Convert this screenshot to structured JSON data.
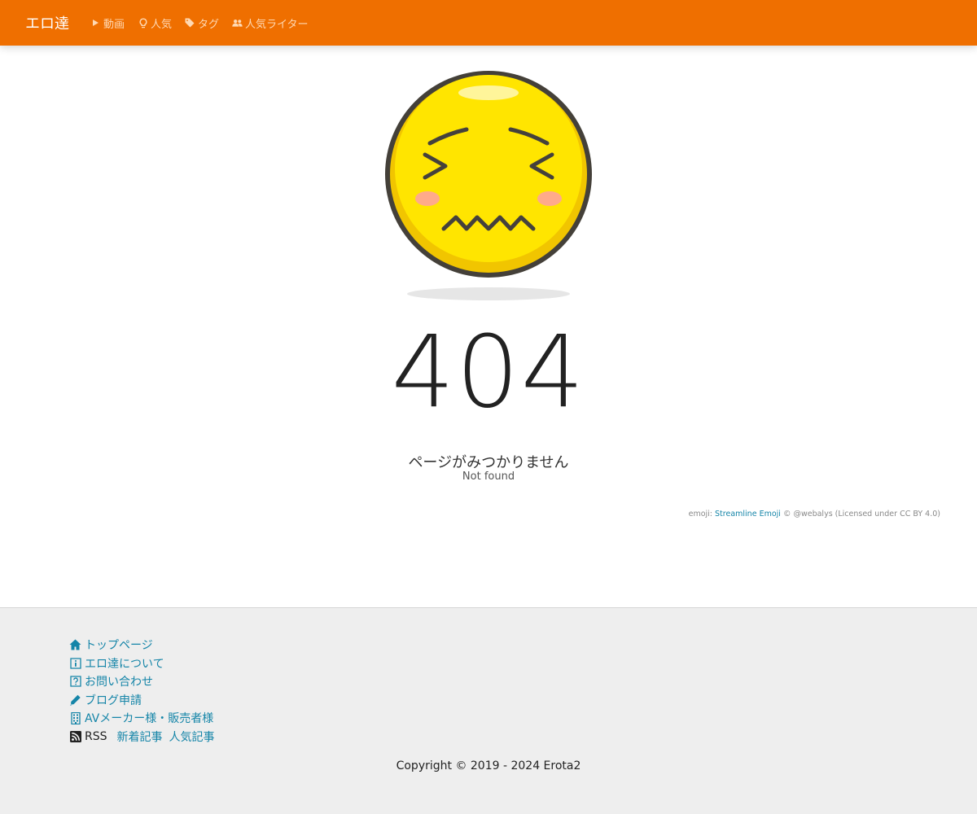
{
  "header": {
    "brand": "エロ達",
    "nav": [
      {
        "label": "動画",
        "icon": "play-icon"
      },
      {
        "label": "人気",
        "icon": "lightbulb-icon"
      },
      {
        "label": "タグ",
        "icon": "tags-icon"
      },
      {
        "label": "人気ライター",
        "icon": "users-icon"
      }
    ]
  },
  "main": {
    "code": "404",
    "message_jp": "ページがみつかりません",
    "message_en": "Not found",
    "credit": {
      "prefix": "emoji: ",
      "link": "Streamline Emoji",
      "suffix": " © @webalys (Licensed under CC BY 4.0)"
    }
  },
  "footer": {
    "links": [
      {
        "label": "トップページ",
        "icon": "home-icon"
      },
      {
        "label": "エロ達について",
        "icon": "info-icon"
      },
      {
        "label": "お問い合わせ",
        "icon": "question-icon"
      },
      {
        "label": "ブログ申請",
        "icon": "pencil-icon"
      },
      {
        "label": "AVメーカー様・販売者様",
        "icon": "building-icon"
      }
    ],
    "rss": {
      "label": "RSS",
      "icon": "rss-icon",
      "links": [
        "新着記事",
        "人気記事"
      ]
    },
    "copyright": "Copyright © 2019 - 2024 Erota2"
  },
  "colors": {
    "header_bg": "#ef6f00",
    "link": "#1585a8",
    "footer_bg": "#eeeeee",
    "emoji_face": "#ffe500"
  }
}
